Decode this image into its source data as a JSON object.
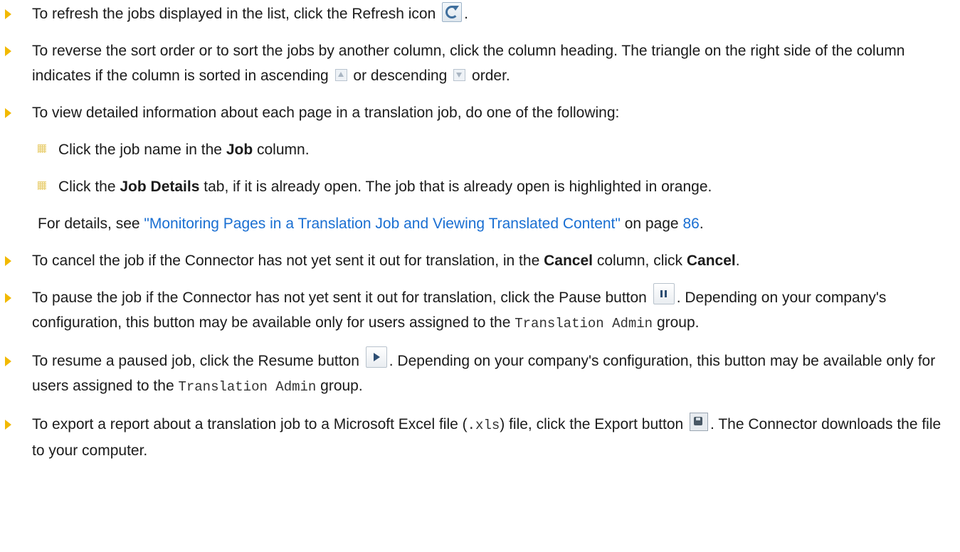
{
  "bullets": [
    {
      "before": "To refresh the jobs displayed in the list, click the Refresh icon",
      "after": "."
    },
    {
      "part1": "To reverse the sort order or to sort the jobs by another column, click the column heading. The triangle on the right side of the column indicates if the column is sorted in ascending",
      "part2": "or descending",
      "part3": "order."
    },
    {
      "text": "To view detailed information about each page in a translation job, do one of the following:",
      "subitems": [
        {
          "prefix": "Click the job name in the",
          "bold": "Job",
          "suffix": "column."
        },
        {
          "prefix": "Click the",
          "bold": "Job Details",
          "suffix": "tab, if it is already open. The job that is already open is highlighted in orange."
        }
      ],
      "note_prefix": "For details, see",
      "note_link": "\"Monitoring Pages in a Translation Job and Viewing Translated Content\"",
      "note_middle": "on page",
      "note_page": "86",
      "note_suffix": "."
    },
    {
      "prefix": "To cancel the job if the Connector has not yet sent it out for translation, in the",
      "bold1": "Cancel",
      "middle": "column, click",
      "bold2": "Cancel",
      "suffix": "."
    },
    {
      "before": "To pause the job if the Connector has not yet sent it out for translation, click the Pause button",
      "after": ". Depending on your company's configuration, this button may be available only for users assigned to the",
      "code": "Translation Admin",
      "end": "group."
    },
    {
      "before": "To resume a paused job, click the Resume button",
      "after": ". Depending on your company's configuration, this button may be available only for users assigned to the",
      "code": "Translation Admin",
      "end": "group."
    },
    {
      "before": "To export a report about a translation job to a Microsoft Excel file (",
      "code": ".xls",
      "middle": ") file, click the Export button",
      "after": ". The Connector downloads the file to your computer."
    }
  ],
  "colors": {
    "bullet_arrow": "#f2b900",
    "link": "#1a6fd2"
  },
  "icons": [
    "refresh-icon",
    "sort-ascending-icon",
    "sort-descending-icon",
    "pause-icon",
    "resume-icon",
    "export-icon"
  ]
}
